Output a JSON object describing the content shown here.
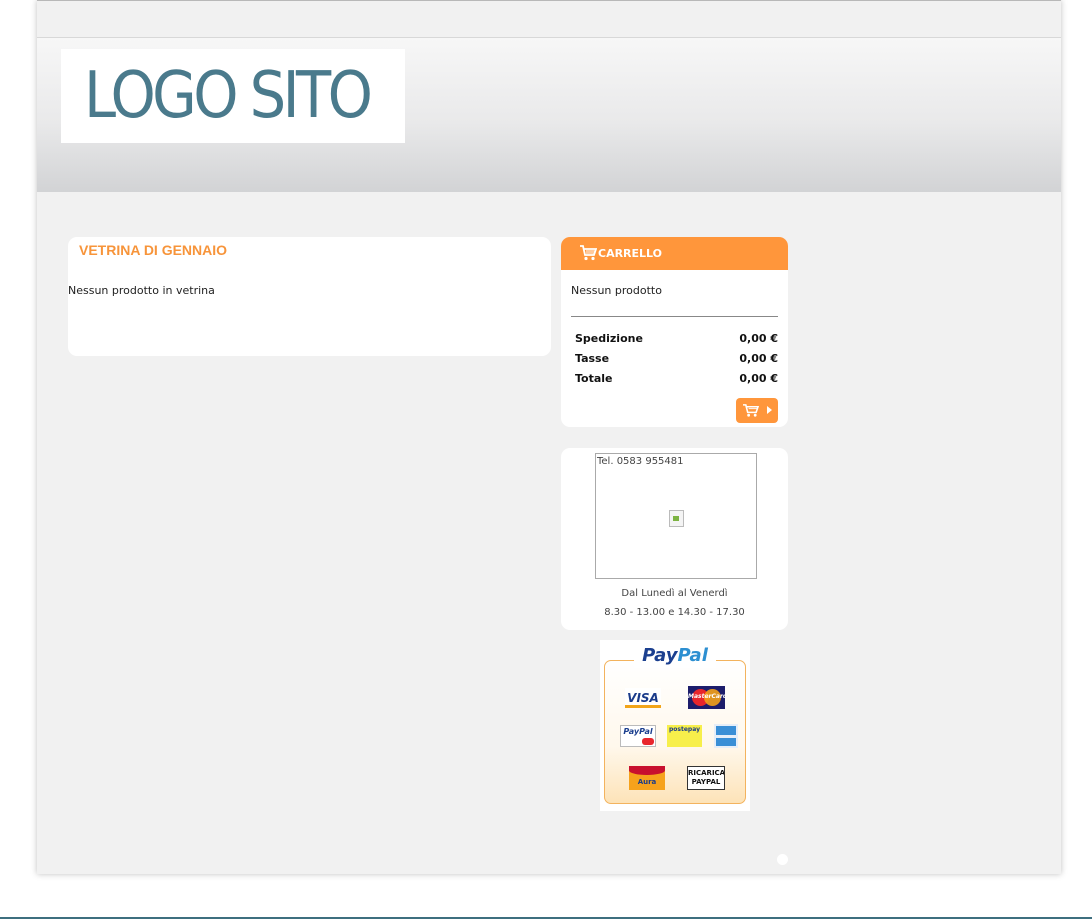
{
  "header": {
    "logo_text": "LOGO SITO"
  },
  "vetrina": {
    "title": "VETRINA DI GENNAIO",
    "empty_text": "Nessun prodotto in vetrina"
  },
  "cart": {
    "title": "CARRELLO",
    "empty_text": "Nessun prodotto",
    "rows": [
      {
        "label": "Spedizione",
        "value": "0,00 €"
      },
      {
        "label": "Tasse",
        "value": "0,00 €"
      },
      {
        "label": "Totale",
        "value": "0,00 €"
      }
    ],
    "checkout_icon": "cart-icon"
  },
  "contact": {
    "tel": "Tel. 0583 955481",
    "days": "Dal Lunedì al Venerdì",
    "hours": "8.30 - 13.00 e 14.30 - 17.30"
  },
  "paypal": {
    "brand_pay": "Pay",
    "brand_pal": "Pal",
    "cards": {
      "visa": "VISA",
      "mastercard": "MasterCard",
      "paypal_small": "PayPal",
      "postepay": "postepay",
      "aura": "Aura",
      "ricarica_1": "RICARICA",
      "ricarica_2": "PAYPAL"
    }
  },
  "colors": {
    "accent": "#ff963b",
    "logo": "#4a7a8c",
    "paypal_blue": "#1b3f8f"
  }
}
